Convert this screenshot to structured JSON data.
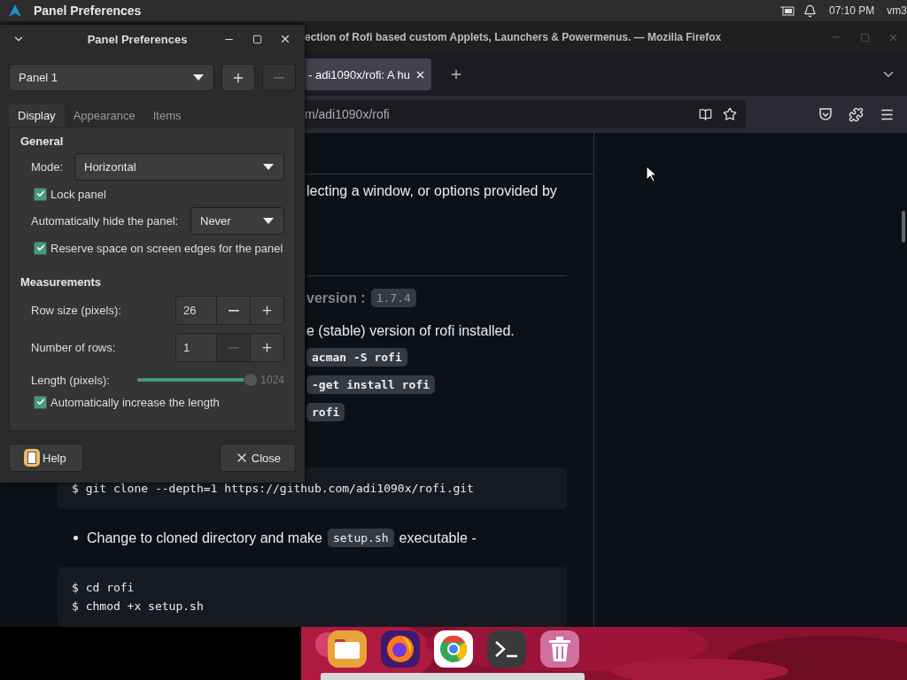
{
  "top_bar": {
    "app_title": "Panel Preferences",
    "clock": "07:10 PM",
    "user": "vm3"
  },
  "browser": {
    "title": "ection of Rofi based custom Applets, Launchers & Powermenus. — Mozilla Firefox",
    "tabs": [
      {
        "label": "- adi1090x/rofi: A hu",
        "selected": true
      }
    ],
    "url": "m/adi1090x/rofi",
    "page_upper": [
      {
        "kind": "text",
        "text": "lecting a window, or options provided by"
      },
      {
        "kind": "rule"
      },
      {
        "kind": "heading",
        "text": "version :",
        "code": "1.7.4"
      },
      {
        "kind": "text",
        "text": "e (stable) version of rofi installed."
      },
      {
        "kind": "code",
        "text": "acman -S rofi"
      },
      {
        "kind": "code",
        "text": "-get install rofi"
      },
      {
        "kind": "code",
        "text": "rofi"
      }
    ],
    "page_lower": [
      {
        "kind": "block",
        "lines": [
          "$ git clone --depth=1 https://github.com/adi1090x/rofi.git"
        ]
      },
      {
        "kind": "bullet",
        "text": "Change to cloned directory and make",
        "code": "setup.sh",
        "after": "executable -"
      },
      {
        "kind": "block",
        "lines": [
          "$ cd rofi",
          "$ chmod +x setup.sh"
        ]
      }
    ]
  },
  "dialog": {
    "title": "Panel Preferences",
    "panel_select": "Panel 1",
    "remove_disabled": true,
    "tabs": [
      {
        "label": "Display",
        "selected": true
      },
      {
        "label": "Appearance",
        "selected": false
      },
      {
        "label": "Items",
        "selected": false
      }
    ],
    "sections": [
      {
        "title": "General",
        "rows": [
          {
            "kind": "select",
            "label": "Mode:",
            "value": "Horizontal"
          },
          {
            "kind": "check",
            "label": "Lock panel",
            "checked": true
          },
          {
            "kind": "select",
            "label": "Automatically hide the panel:",
            "value": "Never"
          },
          {
            "kind": "check",
            "label": "Reserve space on screen edges for the panel",
            "checked": true
          }
        ]
      },
      {
        "title": "Measurements",
        "rows": [
          {
            "kind": "spin",
            "label": "Row size (pixels):",
            "value": "26",
            "minus_disabled": false
          },
          {
            "kind": "spin",
            "label": "Number of rows:",
            "value": "1",
            "minus_disabled": true
          },
          {
            "kind": "slider",
            "label": "Length (pixels):",
            "level": 1.0,
            "reading": "1024"
          },
          {
            "kind": "check",
            "label": "Automatically increase the length",
            "checked": true
          }
        ]
      }
    ],
    "buttons": [
      {
        "kind": "help",
        "label": "Help"
      },
      {
        "kind": "close",
        "label": "Close"
      }
    ]
  },
  "dock": {
    "apps": [
      {
        "kind": "folder"
      },
      {
        "kind": "firefox"
      },
      {
        "kind": "chrome"
      },
      {
        "kind": "terminal"
      },
      {
        "kind": "trash"
      }
    ]
  }
}
